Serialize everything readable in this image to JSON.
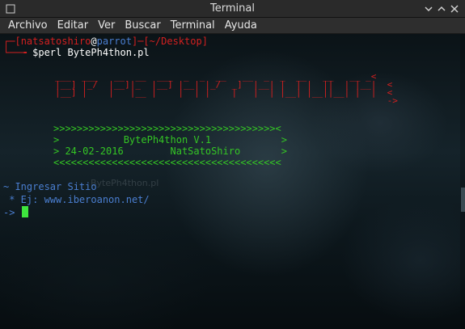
{
  "window": {
    "title": "Terminal"
  },
  "menubar": {
    "items": [
      "Archivo",
      "Editar",
      "Ver",
      "Buscar",
      "Terminal",
      "Ayuda"
    ]
  },
  "prompt": {
    "bracket_open": "┌─[",
    "user": "natsatoshiro",
    "at": "@",
    "host": "parrot",
    "sep": "]─[",
    "path": "~/Desktop",
    "bracket_close": "]",
    "line2_prefix": "└──╼ ",
    "dollar": "$",
    "command": "perl BytePh4thon.pl"
  },
  "banner": {
    "row1": "___  ___   __  __  ___  _  _  __   __  _  _  __   __   __ _<",
    "row2": "|__] |_/  |__]|_  |__] |__| |_/  _]  |__| |  | |  ||  | |__|  <",
    "row3": "|__] |    |   |__ |    |  | |    |   |  | |__| |__||__| |  |  <",
    "row4": "                                                              ->"
  },
  "info_box": {
    "top_border": ">>>>>>>>>>>>>>>>>>>>>>>>>>>>>>>>>>>>>><",
    "line1": ">           BytePh4thon V.1            >",
    "line2": "> 24-02-2016        NatSatoShiro       >",
    "bottom_border": "<<<<<<<<<<<<<<<<<<<<<<<<<<<<<<<<<<<<<<<"
  },
  "watermark": "BytePh4thon.pl",
  "input_section": {
    "heading": "~ Ingresar Sitio",
    "example": " * Ej: www.iberoanon.net/",
    "input_prompt": "-> "
  },
  "colors": {
    "prompt_red": "#d22020",
    "banner_red": "#d22020",
    "box_green": "#34c624",
    "input_blue": "#4a7ed0",
    "cursor_green": "#3ee63e"
  }
}
